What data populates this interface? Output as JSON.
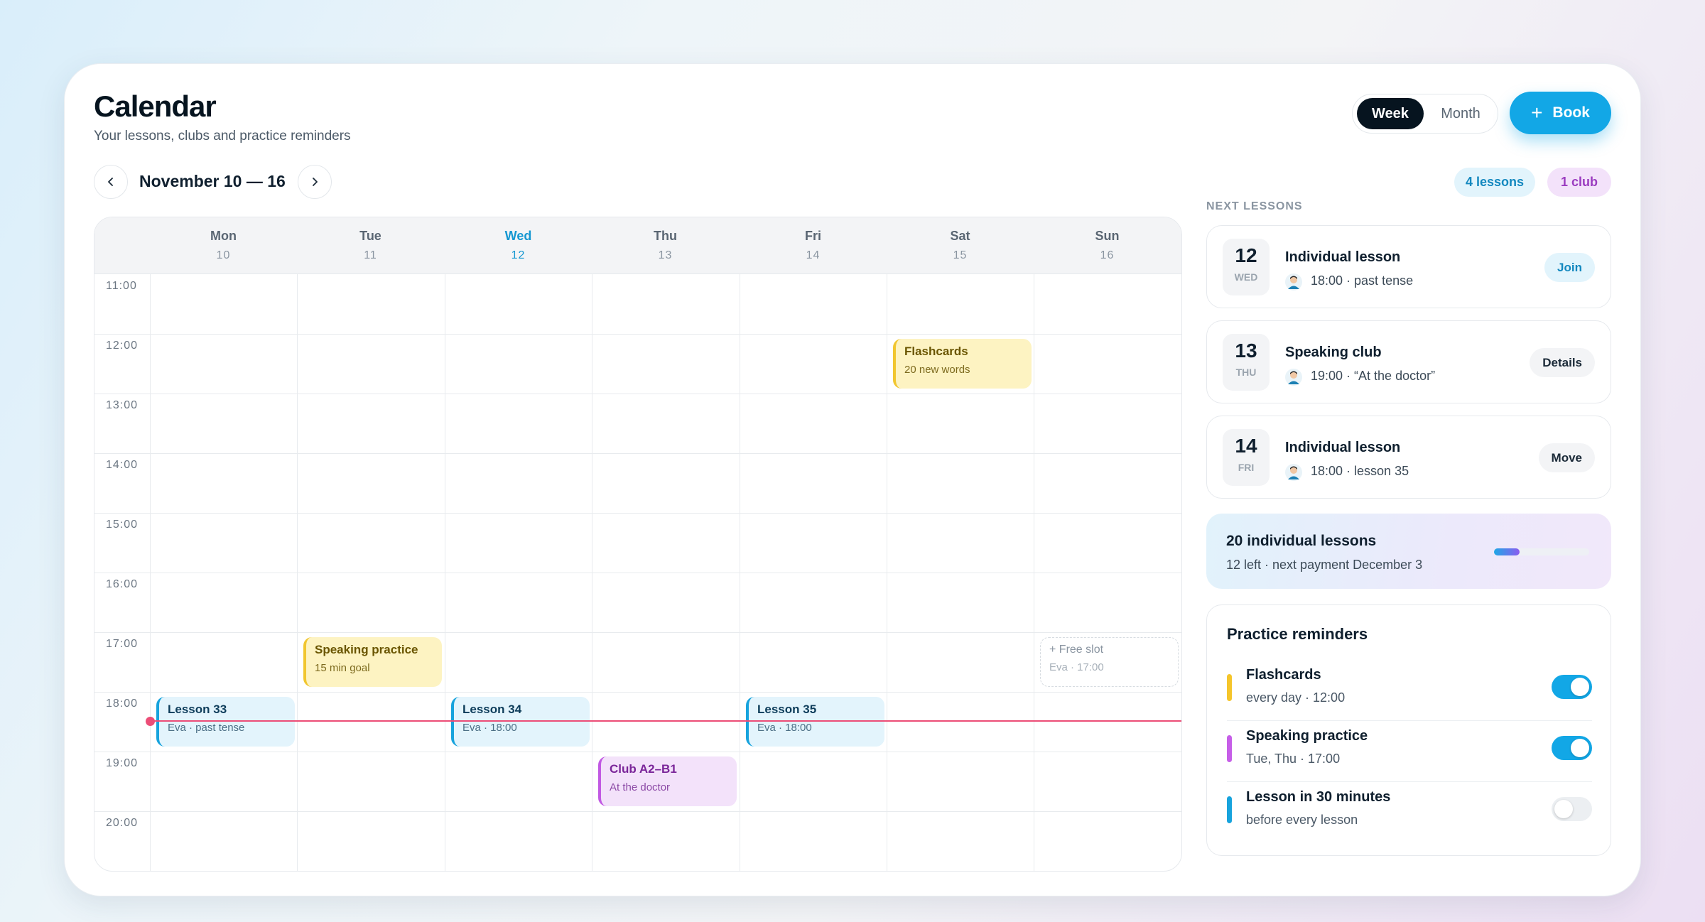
{
  "header": {
    "title": "Calendar",
    "subtitle": "Your lessons, clubs and practice reminders",
    "view_toggle": {
      "week_label": "Week",
      "month_label": "Month",
      "selected": "Week"
    },
    "book_label": "Book"
  },
  "nav": {
    "prev_icon": "chevron-left-icon",
    "next_icon": "chevron-right-icon",
    "range": "November 10 — 16"
  },
  "summary": {
    "lessons_label": "4 lessons",
    "club_label": "1 club"
  },
  "calendar": {
    "days": [
      {
        "name": "Mon",
        "date": "10"
      },
      {
        "name": "Tue",
        "date": "11"
      },
      {
        "name": "Wed",
        "date": "12"
      },
      {
        "name": "Thu",
        "date": "13"
      },
      {
        "name": "Fri",
        "date": "14"
      },
      {
        "name": "Sat",
        "date": "15"
      },
      {
        "name": "Sun",
        "date": "16"
      }
    ],
    "today_index": 2,
    "times": [
      "11:00",
      "12:00",
      "13:00",
      "14:00",
      "15:00",
      "16:00",
      "17:00",
      "18:00",
      "19:00",
      "20:00"
    ],
    "events": [
      {
        "title": "Flashcards",
        "subtitle": "20 new words",
        "color": "yellow"
      },
      {
        "title": "Speaking practice",
        "subtitle": "15 min goal",
        "color": "yellow"
      },
      {
        "title": "+ Free slot",
        "subtitle": "Eva · 17:00",
        "color": "free"
      },
      {
        "title": "Lesson 33",
        "subtitle": "Eva · past tense",
        "color": "blue"
      },
      {
        "title": "Lesson 34",
        "subtitle": "Eva · 18:00",
        "color": "blue"
      },
      {
        "title": "Lesson 35",
        "subtitle": "Eva · 18:00",
        "color": "blue"
      },
      {
        "title": "Club A2–B1",
        "subtitle": "At the doctor",
        "color": "purple"
      }
    ]
  },
  "next_lessons": {
    "label": "NEXT LESSONS",
    "items": [
      {
        "day": "12",
        "weekday": "WED",
        "title": "Individual lesson",
        "subtitle": "18:00 · past tense",
        "action": "Join"
      },
      {
        "day": "13",
        "weekday": "THU",
        "title": "Speaking club",
        "subtitle": "19:00 · “At the doctor”",
        "action": "Details"
      },
      {
        "day": "14",
        "weekday": "FRI",
        "title": "Individual lesson",
        "subtitle": "18:00 · lesson 35",
        "action": "Move"
      }
    ]
  },
  "package": {
    "title": "20 individual lessons",
    "subtitle": "12 left · next payment December 3",
    "progress_fraction": 0.27
  },
  "reminders": {
    "title": "Practice reminders",
    "items": [
      {
        "title": "Flashcards",
        "subtitle": "every day · 12:00",
        "enabled": true,
        "color": "#f5c52b"
      },
      {
        "title": "Speaking practice",
        "subtitle": "Tue, Thu · 17:00",
        "enabled": true,
        "color": "#c65ee8"
      },
      {
        "title": "Lesson in 30 minutes",
        "subtitle": "before every lesson",
        "enabled": false,
        "color": "#17a3dd"
      }
    ]
  },
  "colors": {
    "accent": "#12a7e6",
    "now_line": "#ec4d77",
    "dark": "#06141f"
  }
}
